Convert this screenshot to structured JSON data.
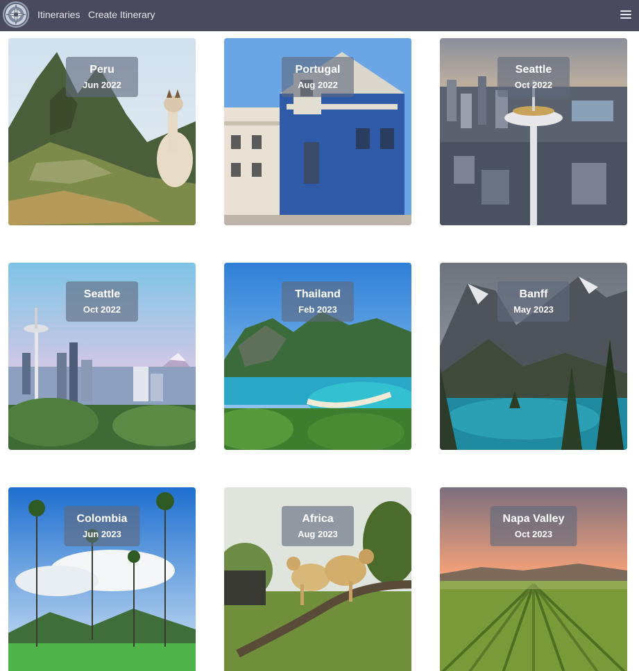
{
  "navbar": {
    "logo_icon": "compass-emblem-icon",
    "links": [
      {
        "label": "Itineraries"
      },
      {
        "label": "Create Itinerary"
      }
    ],
    "menu_icon": "hamburger-menu-icon"
  },
  "itineraries": [
    {
      "destination": "Peru",
      "date": "Jun 2022",
      "scene": "mountain ruins with llama"
    },
    {
      "destination": "Portugal",
      "date": "Aug 2022",
      "scene": "blue tiled church"
    },
    {
      "destination": "Seattle",
      "date": "Oct 2022",
      "scene": "space needle aerial city"
    },
    {
      "destination": "Seattle",
      "date": "Oct 2022",
      "scene": "skyline with mountain"
    },
    {
      "destination": "Thailand",
      "date": "Feb 2023",
      "scene": "tropical bay"
    },
    {
      "destination": "Banff",
      "date": "May 2023",
      "scene": "alpine lake"
    },
    {
      "destination": "Colombia",
      "date": "Jun 2023",
      "scene": "wax palms valley"
    },
    {
      "destination": "Africa",
      "date": "Aug 2023",
      "scene": "leopards on branch"
    },
    {
      "destination": "Napa Valley",
      "date": "Oct 2023",
      "scene": "vineyard sunset"
    }
  ],
  "colors": {
    "navbar_bg": "#4a4a5e",
    "nav_text": "#e6e7ee",
    "badge_bg": "rgba(95,105,125,0.62)"
  }
}
